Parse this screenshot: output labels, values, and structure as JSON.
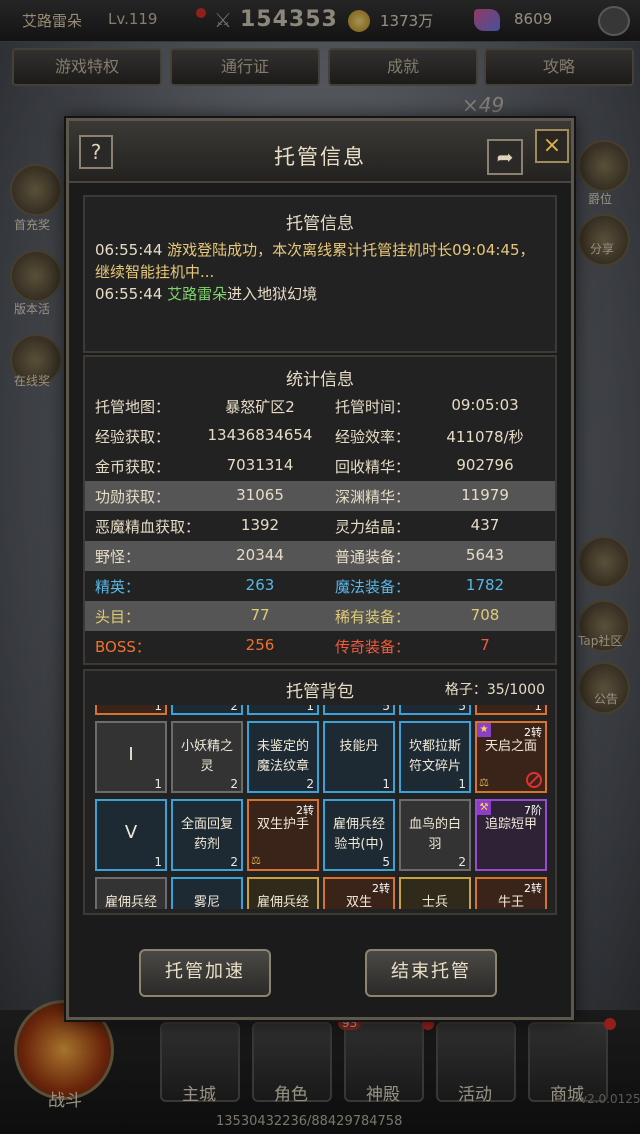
{
  "player": {
    "name": "艾路雷朵",
    "level": "Lv.119",
    "power": "154353",
    "gold": "1373万",
    "gems": "8609"
  },
  "top_menu": [
    {
      "label": "游戏特权"
    },
    {
      "label": "通行证"
    },
    {
      "label": "成就"
    },
    {
      "label": "攻略"
    }
  ],
  "scene": {
    "multiplier": "×49"
  },
  "dialog": {
    "title": "托管信息",
    "help_label": "?",
    "close_label": "×",
    "log_panel": {
      "title": "托管信息",
      "lines": [
        {
          "time": "06:55:44",
          "text": "游戏登陆成功，本次离线累计托管挂机时长09:04:45，继续智能挂机中..."
        },
        {
          "time": "06:55:44",
          "name": "艾路雷朵",
          "text": "进入地狱幻境"
        }
      ]
    },
    "stats_panel": {
      "title": "统计信息",
      "rows": [
        {
          "k1": "托管地图：",
          "v1": "暴怒矿区2",
          "k2": "托管时间：",
          "v2": "09:05:03",
          "color": "white",
          "highlight": false
        },
        {
          "k1": "经验获取：",
          "v1": "13436834654",
          "k2": "经验效率：",
          "v2": "411078/秒",
          "color": "white",
          "highlight": false
        },
        {
          "k1": "金币获取：",
          "v1": "7031314",
          "k2": "回收精华：",
          "v2": "902796",
          "color": "white",
          "highlight": false
        },
        {
          "k1": "功勋获取：",
          "v1": "31065",
          "k2": "深渊精华：",
          "v2": "11979",
          "color": "white",
          "highlight": true
        },
        {
          "k1": "恶魔精血获取：",
          "v1": "1392",
          "k2": "灵力结晶：",
          "v2": "437",
          "color": "white",
          "highlight": false
        },
        {
          "k1": "野怪：",
          "v1": "20344",
          "k2": "普通装备：",
          "v2": "5643",
          "color": "white",
          "highlight": true
        },
        {
          "k1": "精英：",
          "v1": "263",
          "k2": "魔法装备：",
          "v2": "1782",
          "color": "blue",
          "highlight": false
        },
        {
          "k1": "头目：",
          "v1": "77",
          "k2": "稀有装备：",
          "v2": "708",
          "color": "yellow",
          "highlight": true
        },
        {
          "k1": "BOSS：",
          "v1": "256",
          "k2": "传奇装备：",
          "v2": "7",
          "color": "orange",
          "highlight": false
        }
      ]
    },
    "bag_panel": {
      "title": "托管背包",
      "slots_label": "格子：35/1000",
      "partial_counts": [
        "1",
        "2",
        "1",
        "5",
        "5",
        "1"
      ],
      "items": [
        {
          "name": "I",
          "count": "1",
          "rarity": "gray",
          "big": true,
          "tag": ""
        },
        {
          "name": "小妖精之灵",
          "count": "2",
          "rarity": "gray",
          "big": false,
          "tag": ""
        },
        {
          "name": "未鉴定的魔法纹章",
          "count": "2",
          "rarity": "blue",
          "big": false,
          "tag": ""
        },
        {
          "name": "技能丹",
          "count": "1",
          "rarity": "blue",
          "big": false,
          "tag": ""
        },
        {
          "name": "坎都拉斯符文碎片",
          "count": "1",
          "rarity": "blue",
          "big": false,
          "tag": ""
        },
        {
          "name": "天启之面",
          "count": "",
          "rarity": "orange",
          "big": false,
          "tag": "2转"
        },
        {
          "name": "V",
          "count": "1",
          "rarity": "blue",
          "big": true,
          "tag": ""
        },
        {
          "name": "全面回复药剂",
          "count": "2",
          "rarity": "blue",
          "big": false,
          "tag": ""
        },
        {
          "name": "双生护手",
          "count": "",
          "rarity": "orange",
          "big": false,
          "tag": "2转"
        },
        {
          "name": "雇佣兵经验书(中)",
          "count": "5",
          "rarity": "blue",
          "big": false,
          "tag": ""
        },
        {
          "name": "血鸟的白羽",
          "count": "2",
          "rarity": "gray",
          "big": false,
          "tag": ""
        },
        {
          "name": "追踪短甲",
          "count": "",
          "rarity": "purple",
          "big": false,
          "tag": "7阶"
        },
        {
          "name": "雇佣兵经",
          "count": "",
          "rarity": "gray",
          "big": false,
          "tag": ""
        },
        {
          "name": "雾尼",
          "count": "",
          "rarity": "blue",
          "big": false,
          "tag": ""
        },
        {
          "name": "雇佣兵经",
          "count": "",
          "rarity": "gold",
          "big": false,
          "tag": ""
        },
        {
          "name": "双生",
          "count": "",
          "rarity": "orange",
          "big": false,
          "tag": "2转"
        },
        {
          "name": "士兵",
          "count": "",
          "rarity": "gold",
          "big": false,
          "tag": ""
        },
        {
          "name": "牛王",
          "count": "",
          "rarity": "orange",
          "big": false,
          "tag": "2转"
        }
      ]
    },
    "buttons": {
      "accelerate": "托管加速",
      "end": "结束托管"
    }
  },
  "side_left": [
    {
      "label": "首充奖"
    },
    {
      "label": "版本活"
    },
    {
      "label": "在线奖"
    }
  ],
  "side_right": [
    {
      "label": "爵位"
    },
    {
      "label": "分享"
    },
    {
      "label": "Tap社区"
    },
    {
      "label": "公告"
    }
  ],
  "bottom_nav": [
    {
      "label": "战斗"
    },
    {
      "label": "主城"
    },
    {
      "label": "角色"
    },
    {
      "label": "神殿"
    },
    {
      "label": "活动"
    },
    {
      "label": "商城"
    }
  ],
  "bottom_badge": "93",
  "footer": {
    "player_id": "13530432236/88429784758",
    "version": "v2.0.0125"
  }
}
